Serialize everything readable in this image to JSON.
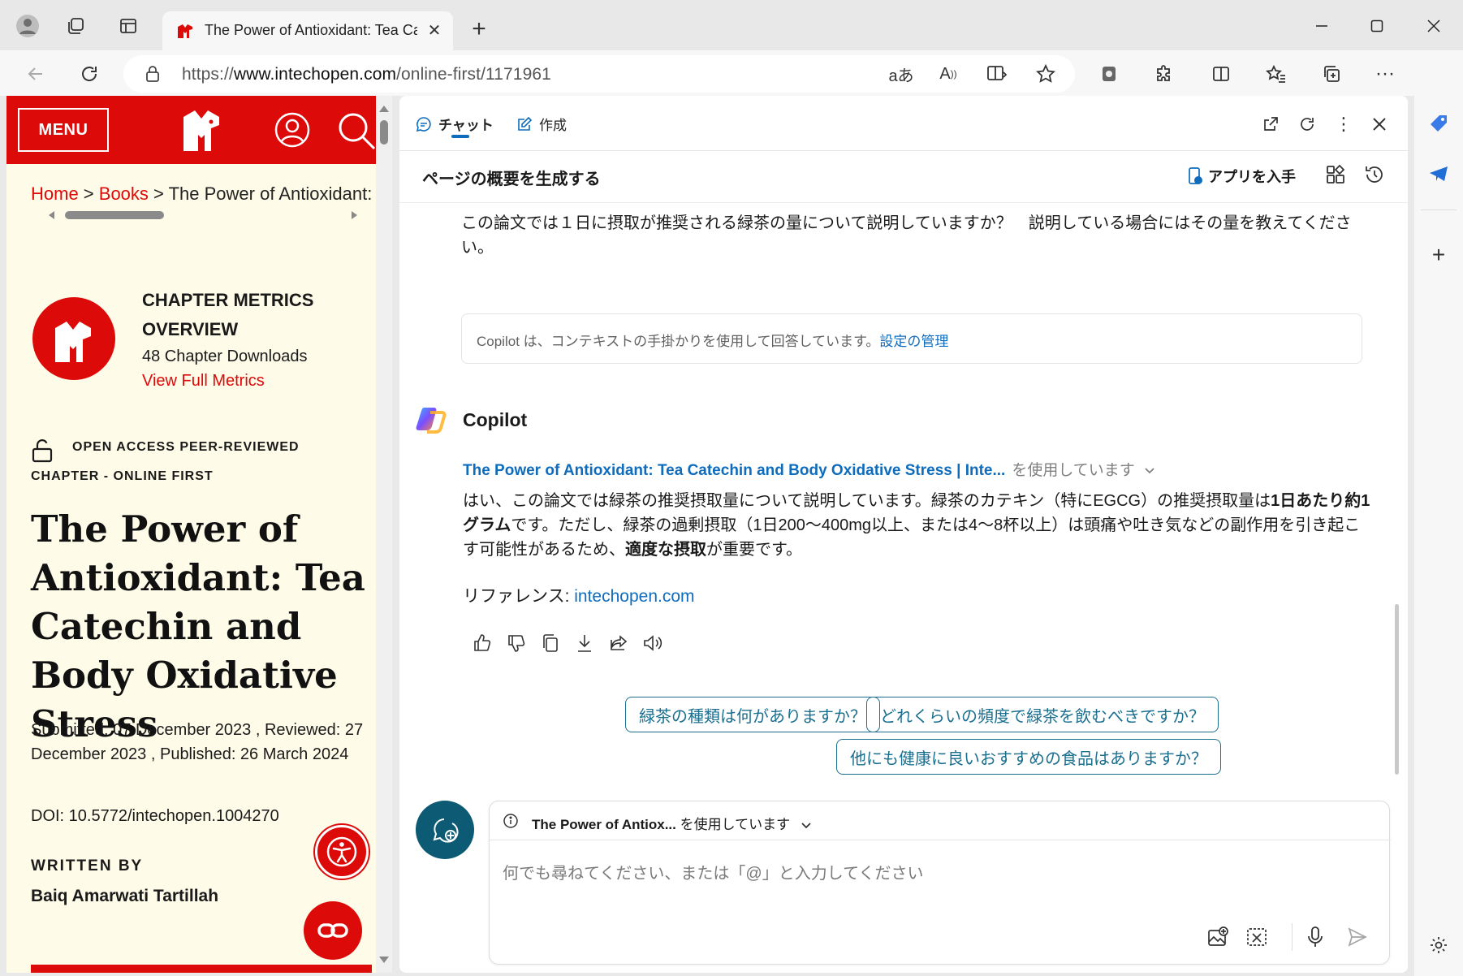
{
  "browser": {
    "tab_title": "The Power of Antioxidant: Tea Ca",
    "url_prefix": "https://",
    "url_domain": "www.intechopen.com",
    "url_path": "/online-first/1171961"
  },
  "site": {
    "menu_label": "MENU",
    "breadcrumb": {
      "home": "Home",
      "sep1": " > ",
      "books": "Books",
      "sep2": " > ",
      "current": "The Power of Antioxidant:"
    },
    "metrics": {
      "title": "CHAPTER METRICS OVERVIEW",
      "downloads": "48 Chapter Downloads",
      "link": "View Full Metrics"
    },
    "access_line1": "OPEN ACCESS PEER-REVIEWED",
    "access_line2": "CHAPTER - ONLINE FIRST",
    "title": "The Power of Antioxidant: Tea Catechin and Body Oxidative Stress",
    "dates": "Submitted: 07 December 2023 , Reviewed: 27 December 2023 , Published: 26 March 2024",
    "doi": "DOI: 10.5772/intechopen.1004270",
    "written_by": "WRITTEN BY",
    "author": "Baiq Amarwati Tartillah"
  },
  "copilot": {
    "tabs": {
      "chat": "チャット",
      "compose": "作成"
    },
    "summary_title": "ページの概要を生成する",
    "get_app": "アプリを入手",
    "user_question": "この論文では１日に摂取が推奨される緑茶の量について説明していますか？　説明している場合にはその量を教えてください。",
    "context_notice": "Copilot は、コンテキストの手掛かりを使用して回答しています。",
    "context_link": "設定の管理",
    "assistant_name": "Copilot",
    "source_title": "The Power of Antioxidant: Tea Catechin and Body Oxidative Stress | Inte...",
    "source_using": "を使用しています",
    "answer": {
      "p1": "はい、この論文では緑茶の推奨摂取量について説明しています。緑茶のカテキン（特にEGCG）の推奨摂取量は",
      "b1": "1日あたり約1グラム",
      "p2": "です。ただし、緑茶の過剰摂取（1日200～400mg以上、または4～8杯以上）は頭痛や吐き気などの副作用を引き起こす可能性があるため、",
      "b2": "適度な摂取",
      "p3": "が重要です。"
    },
    "reference_label": "リファレンス: ",
    "reference_link": "intechopen.com",
    "suggestions": [
      "緑茶の種類は何がありますか？",
      "どれくらいの頻度で緑茶を飲むべきですか？",
      "他にも健康に良いおすすめの食品はありますか？"
    ],
    "input_context_title": "The Power of Antiox...",
    "input_context_suffix": " を使用しています",
    "input_placeholder": "何でも尋ねてください、または「@」と入力してください"
  },
  "colors": {
    "brand_red": "#dd0a0a",
    "page_bg": "#fefbe9",
    "link_blue": "#0f6cbd",
    "suggestion_teal": "#1b6f8f",
    "newchat_teal": "#0c5a73"
  }
}
